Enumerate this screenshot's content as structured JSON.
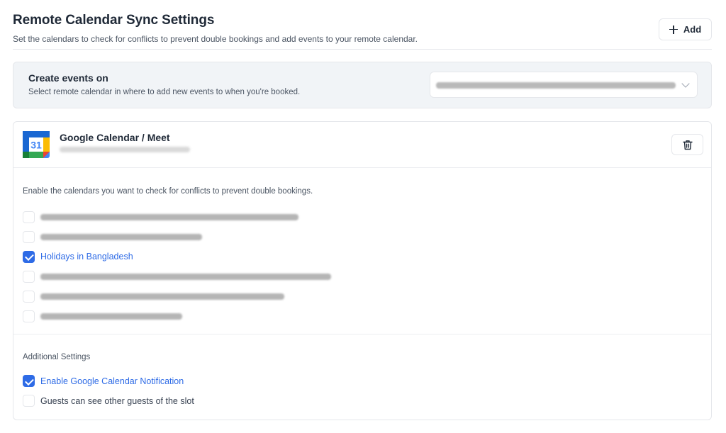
{
  "header": {
    "title": "Remote Calendar Sync Settings",
    "subtitle": "Set the calendars to check for conflicts to prevent double bookings and add events to your remote calendar.",
    "add_label": "Add"
  },
  "create_events": {
    "title": "Create events on",
    "description": "Select remote calendar in where to add new events to when you're booked.",
    "selected_calendar": ""
  },
  "provider": {
    "name": "Google Calendar / Meet",
    "logo_text": "31",
    "email": ""
  },
  "conflicts": {
    "help_text": "Enable the calendars you want to check for conflicts to prevent double bookings.",
    "calendars": [
      {
        "label": "",
        "checked": false
      },
      {
        "label": "",
        "checked": false
      },
      {
        "label": "Holidays in Bangladesh",
        "checked": true
      },
      {
        "label": "",
        "checked": false
      },
      {
        "label": "",
        "checked": false
      },
      {
        "label": "",
        "checked": false
      }
    ]
  },
  "additional_settings": {
    "title": "Additional Settings",
    "items": [
      {
        "label": "Enable Google Calendar Notification",
        "checked": true
      },
      {
        "label": "Guests can see other guests of the slot",
        "checked": false
      }
    ]
  },
  "colors": {
    "accent": "#2e6be6",
    "panel_bg": "#f1f4f7",
    "border": "#e5e7eb"
  }
}
